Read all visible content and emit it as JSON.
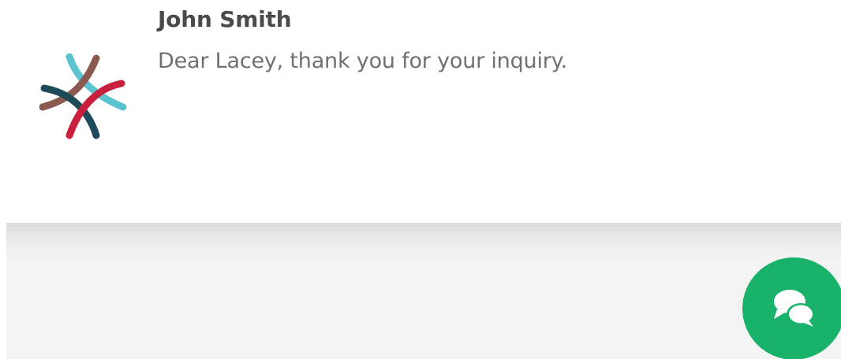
{
  "message": {
    "sender": "John Smith",
    "preview": "Dear Lacey, thank you for your inquiry.",
    "avatar_icon": "brand-logo-icon"
  },
  "chat_button": {
    "icon": "chat-bubbles-icon",
    "color": "#18b26b"
  },
  "colors": {
    "logo_teal": "#5bc3cf",
    "logo_brown": "#8a5a4f",
    "logo_navy": "#1f4a5a",
    "logo_red": "#c9203e",
    "footer_bg": "#f4f4f4"
  }
}
